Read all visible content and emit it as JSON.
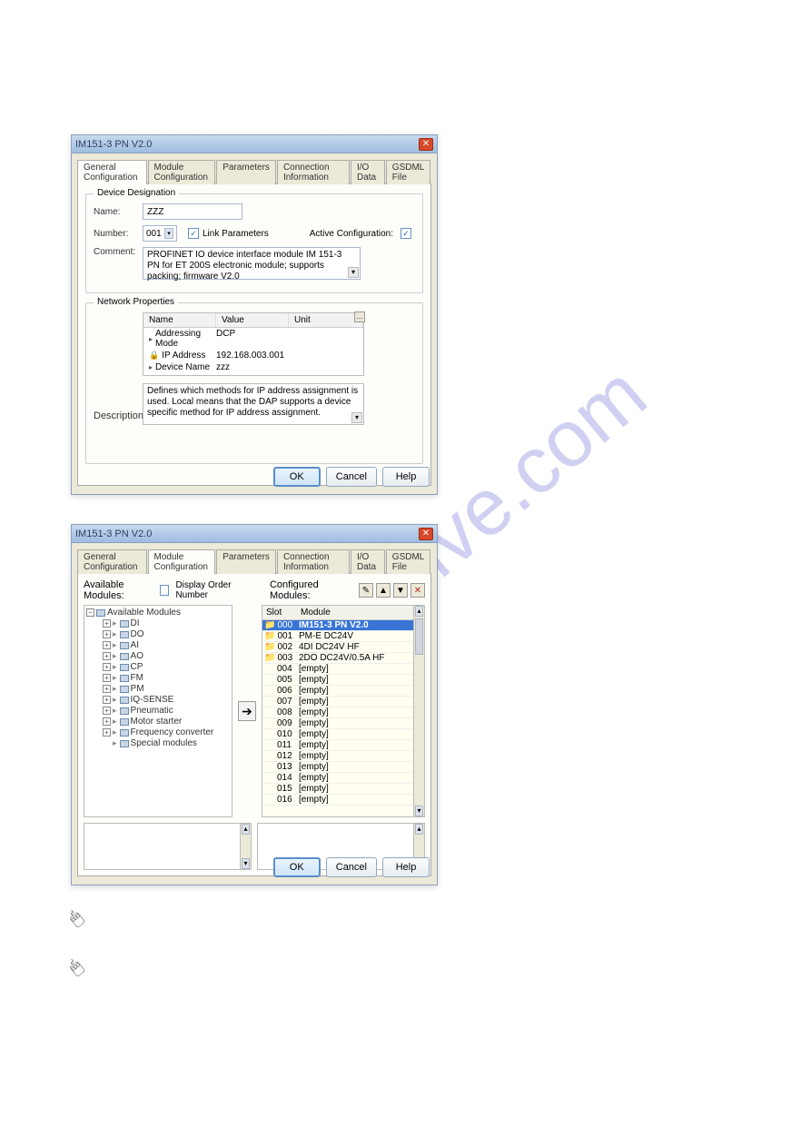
{
  "watermark": "manualslive.com",
  "dlg1": {
    "title": "IM151-3 PN V2.0",
    "tabs": [
      "General Configuration",
      "Module Configuration",
      "Parameters",
      "Connection Information",
      "I/O Data",
      "GSDML File"
    ],
    "activeTab": 0,
    "grp_device": "Device Designation",
    "name_lbl": "Name:",
    "name_val": "ZZZ",
    "number_lbl": "Number:",
    "number_val": "001",
    "link_params": "Link Parameters",
    "active_cfg": "Active Configuration:",
    "comment_lbl": "Comment:",
    "comment_val": "PROFINET IO device interface module IM 151-3 PN for ET 200S electronic module; supports packing; firmware V2.0",
    "grp_net": "Network Properties",
    "np_head": [
      "Name",
      "Value",
      "Unit"
    ],
    "np_rows": [
      {
        "name": "Addressing Mode",
        "value": "DCP",
        "icon": "tri"
      },
      {
        "name": "IP Address",
        "value": "192.168.003.001",
        "icon": "lock"
      },
      {
        "name": "Device Name",
        "value": "zzz",
        "icon": "tri"
      }
    ],
    "desc_lbl": "Description:",
    "desc_val": "Defines which methods for IP address assignment is used. Local means that the DAP supports a device specific method for IP address assignment.",
    "btn_ok": "OK",
    "btn_cancel": "Cancel",
    "btn_help": "Help"
  },
  "dlg2": {
    "title": "IM151-3 PN V2.0",
    "tabs": [
      "General Configuration",
      "Module Configuration",
      "Parameters",
      "Connection Information",
      "I/O Data",
      "GSDML File"
    ],
    "activeTab": 1,
    "avail_lbl": "Available Modules:",
    "disp_order": "Display Order Number",
    "cfg_lbl": "Configured Modules:",
    "tree_root": "Available Modules",
    "tree_items": [
      "DI",
      "DO",
      "AI",
      "AO",
      "CP",
      "FM",
      "PM",
      "IQ-SENSE",
      "Pneumatic",
      "Motor starter",
      "Frequency converter",
      "Special modules"
    ],
    "cfg_head": [
      "Slot",
      "Module"
    ],
    "cfg_rows": [
      {
        "slot": "000",
        "mod": "IM151-3 PN V2.0",
        "sel": true,
        "fold": true
      },
      {
        "slot": "001",
        "mod": "PM-E DC24V",
        "fold": true
      },
      {
        "slot": "002",
        "mod": "4DI DC24V HF",
        "fold": true
      },
      {
        "slot": "003",
        "mod": "2DO DC24V/0.5A HF",
        "fold": true
      },
      {
        "slot": "004",
        "mod": "[empty]"
      },
      {
        "slot": "005",
        "mod": "[empty]"
      },
      {
        "slot": "006",
        "mod": "[empty]"
      },
      {
        "slot": "007",
        "mod": "[empty]"
      },
      {
        "slot": "008",
        "mod": "[empty]"
      },
      {
        "slot": "009",
        "mod": "[empty]"
      },
      {
        "slot": "010",
        "mod": "[empty]"
      },
      {
        "slot": "011",
        "mod": "[empty]"
      },
      {
        "slot": "012",
        "mod": "[empty]"
      },
      {
        "slot": "013",
        "mod": "[empty]"
      },
      {
        "slot": "014",
        "mod": "[empty]"
      },
      {
        "slot": "015",
        "mod": "[empty]"
      },
      {
        "slot": "016",
        "mod": "[empty]"
      }
    ],
    "btn_ok": "OK",
    "btn_cancel": "Cancel",
    "btn_help": "Help"
  }
}
